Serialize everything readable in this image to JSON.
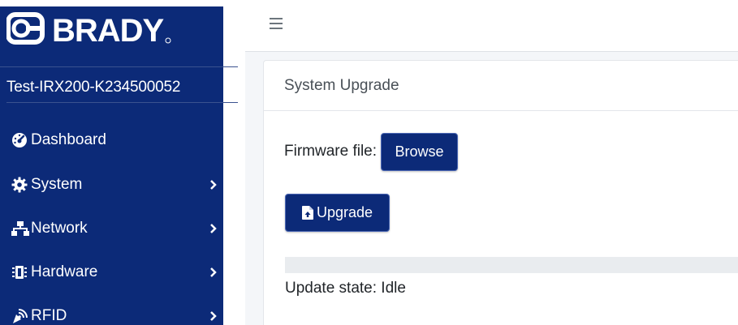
{
  "brand": {
    "name": "BRADY",
    "accent": "#0c2a78"
  },
  "device": {
    "name": "Test-IRX200-K234500052"
  },
  "sidebar": {
    "items": [
      {
        "label": "Dashboard",
        "icon": "tachometer-icon",
        "has_submenu": false
      },
      {
        "label": "System",
        "icon": "gear-icon",
        "has_submenu": true
      },
      {
        "label": "Network",
        "icon": "network-icon",
        "has_submenu": true
      },
      {
        "label": "Hardware",
        "icon": "chip-icon",
        "has_submenu": true
      },
      {
        "label": "RFID",
        "icon": "rfid-signal-icon",
        "has_submenu": true
      }
    ]
  },
  "topbar": {
    "menu_icon": "hamburger-icon"
  },
  "card": {
    "title": "System Upgrade",
    "firmware_label": "Firmware file:",
    "browse_label": "Browse",
    "upgrade_label": "Upgrade",
    "upgrade_icon": "file-upload-icon",
    "progress_fraction": 0,
    "status_prefix": "Update state: ",
    "status_value": "Idle"
  }
}
